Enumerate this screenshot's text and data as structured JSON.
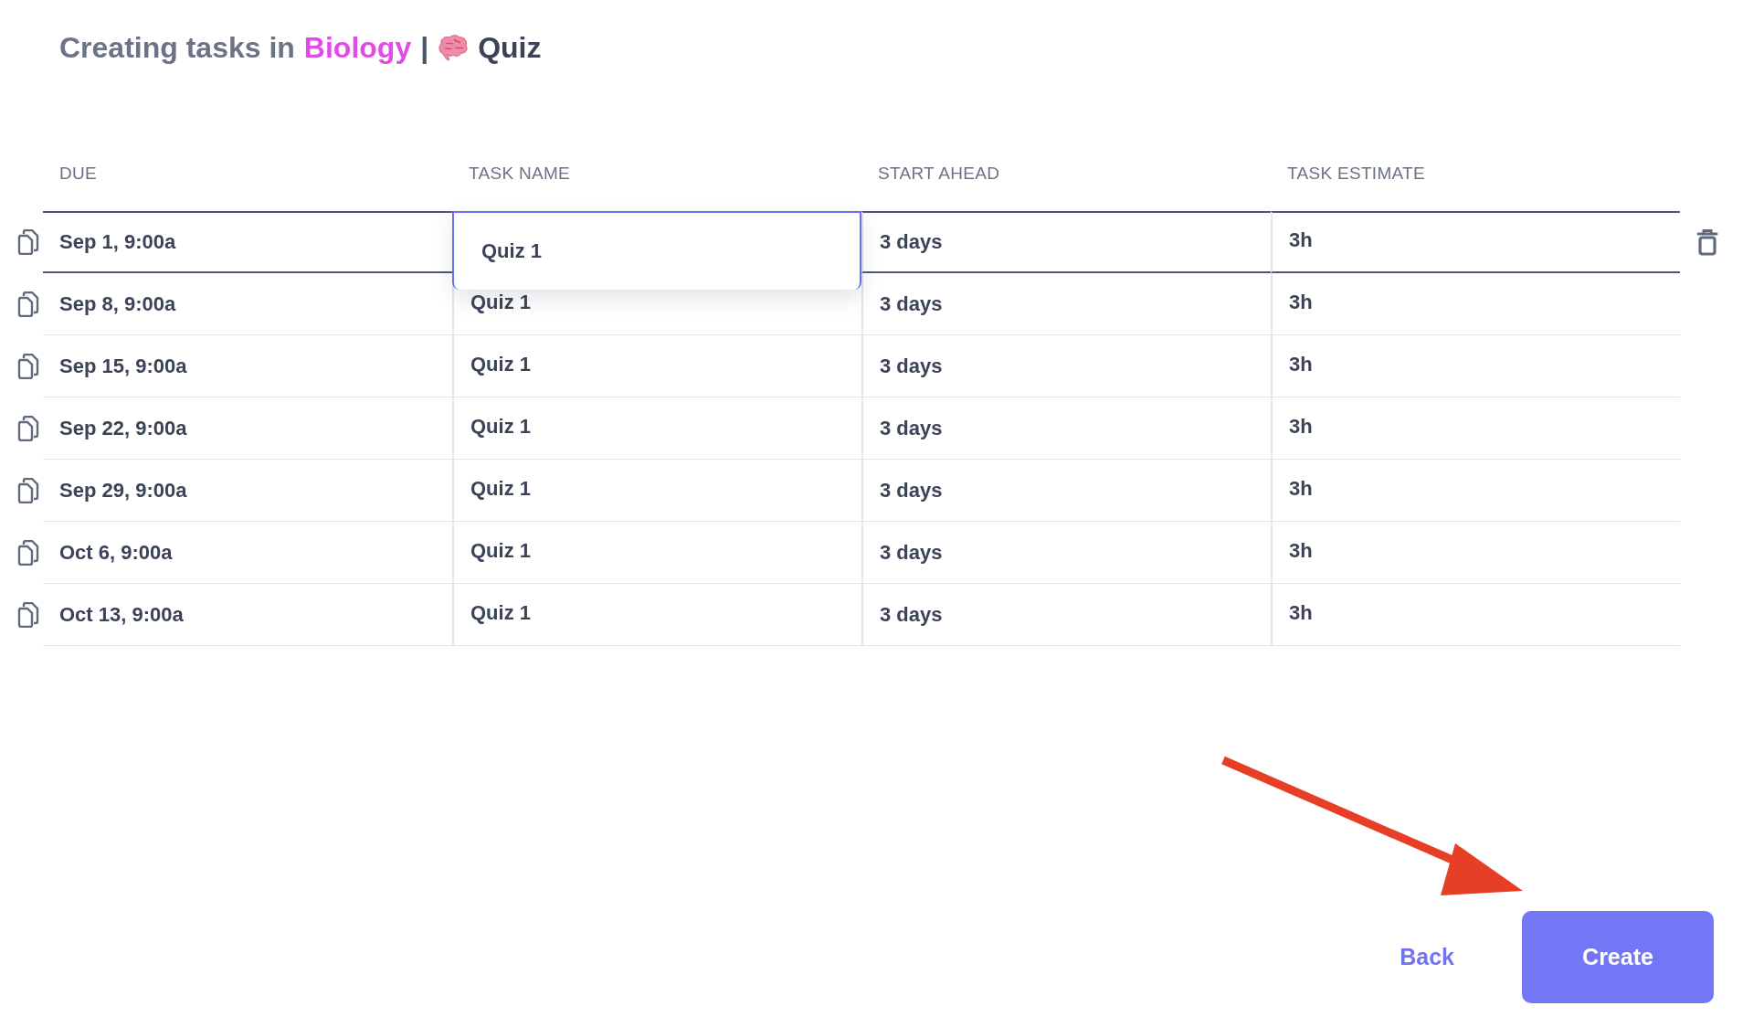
{
  "title": {
    "prefix": "Creating tasks in",
    "course": "Biology",
    "separator": "|",
    "task_type": "Quiz"
  },
  "table": {
    "columns": [
      "DUE",
      "TASK NAME",
      "START AHEAD",
      "TASK ESTIMATE"
    ],
    "rows": [
      {
        "due": "Sep 1, 9:00a",
        "name": "Quiz 1",
        "start_ahead": "3 days",
        "estimate": "3h",
        "editing": true
      },
      {
        "due": "Sep 8, 9:00a",
        "name": "Quiz 1",
        "start_ahead": "3 days",
        "estimate": "3h",
        "editing": false
      },
      {
        "due": "Sep 15, 9:00a",
        "name": "Quiz 1",
        "start_ahead": "3 days",
        "estimate": "3h",
        "editing": false
      },
      {
        "due": "Sep 22, 9:00a",
        "name": "Quiz 1",
        "start_ahead": "3 days",
        "estimate": "3h",
        "editing": false
      },
      {
        "due": "Sep 29, 9:00a",
        "name": "Quiz 1",
        "start_ahead": "3 days",
        "estimate": "3h",
        "editing": false
      },
      {
        "due": "Oct 6, 9:00a",
        "name": "Quiz 1",
        "start_ahead": "3 days",
        "estimate": "3h",
        "editing": false
      },
      {
        "due": "Oct 13, 9:00a",
        "name": "Quiz 1",
        "start_ahead": "3 days",
        "estimate": "3h",
        "editing": false
      }
    ]
  },
  "actions": {
    "back": "Back",
    "create": "Create"
  }
}
